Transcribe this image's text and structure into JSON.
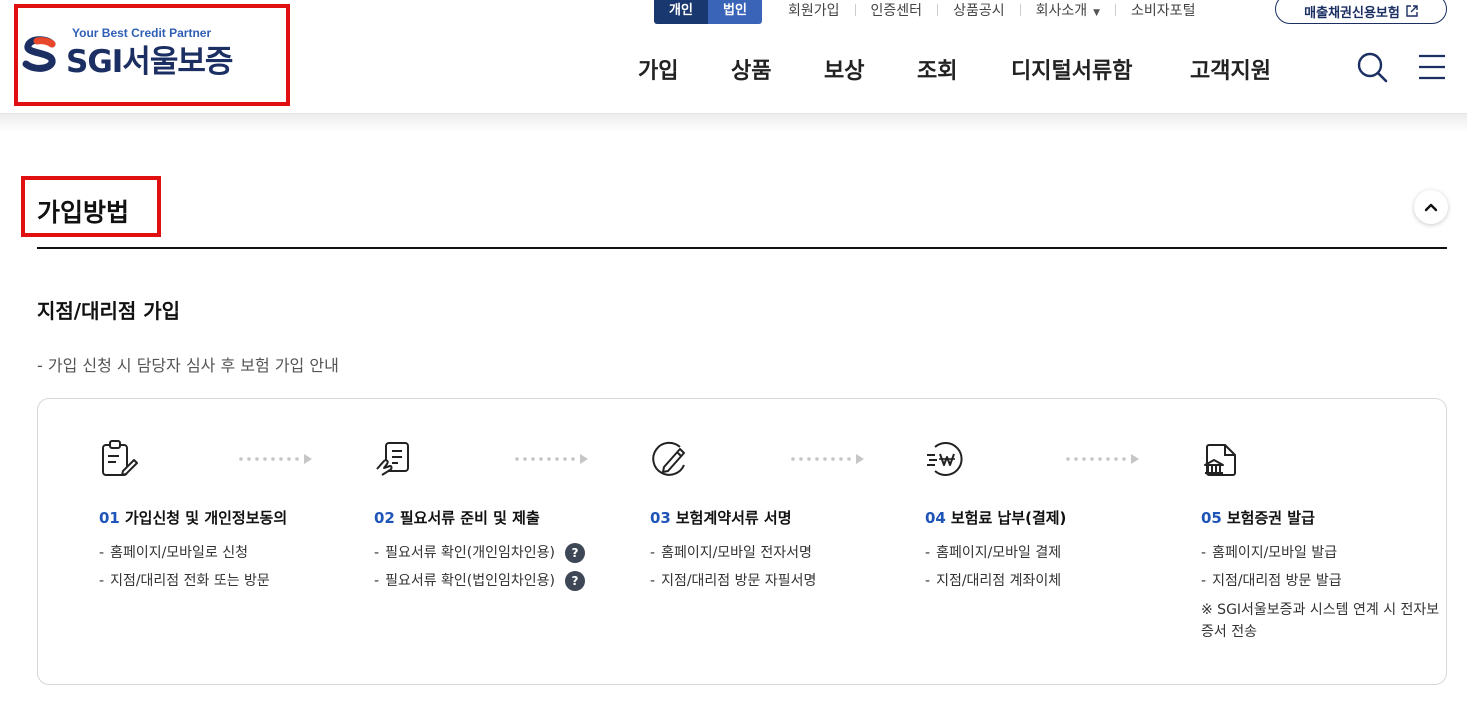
{
  "header": {
    "logo_tagline": "Your Best Credit Partner",
    "logo_text": "SGI서울보증",
    "toggle": [
      "개인",
      "법인"
    ],
    "utility_links": [
      "회원가입",
      "인증센터",
      "상품공시",
      "회사소개",
      "소비자포털"
    ],
    "external_button": "매출채권신용보험",
    "gnb": [
      "가입",
      "상품",
      "보상",
      "조회",
      "디지털서류함",
      "고객지원"
    ]
  },
  "section": {
    "title": "가입방법",
    "subtitle": "지점/대리점 가입",
    "note": "- 가입 신청 시 담당자 심사 후 보험 가입 안내"
  },
  "steps": [
    {
      "num": "01",
      "title": "가입신청 및 개인정보동의",
      "lines": [
        "홈페이지/모바일로 신청",
        "지점/대리점 전화 또는 방문"
      ],
      "icon": "clipboard-edit-icon"
    },
    {
      "num": "02",
      "title": "필요서류 준비 및 제출",
      "lines": [
        "필요서류 확인(개인임차인용)",
        "필요서류 확인(법인임차인용)"
      ],
      "help": "?",
      "icon": "document-hand-icon"
    },
    {
      "num": "03",
      "title": "보험계약서류 서명",
      "lines": [
        "홈페이지/모바일 전자서명",
        "지점/대리점 방문 자필서명"
      ],
      "icon": "pen-sign-icon"
    },
    {
      "num": "04",
      "title": "보험료 납부(결제)",
      "lines": [
        "홈페이지/모바일 결제",
        "지점/대리점 계좌이체"
      ],
      "icon": "won-payment-icon"
    },
    {
      "num": "05",
      "title": "보험증권 발급",
      "lines": [
        "홈페이지/모바일 발급",
        "지점/대리점 방문 발급"
      ],
      "note": "※ SGI서울보증과 시스템 연계 시 전자보증서 전송",
      "icon": "certificate-icon"
    }
  ],
  "colors": {
    "brand_navy": "#1b2f63",
    "accent_blue": "#1f55b8",
    "highlight_red": "#e01010"
  }
}
